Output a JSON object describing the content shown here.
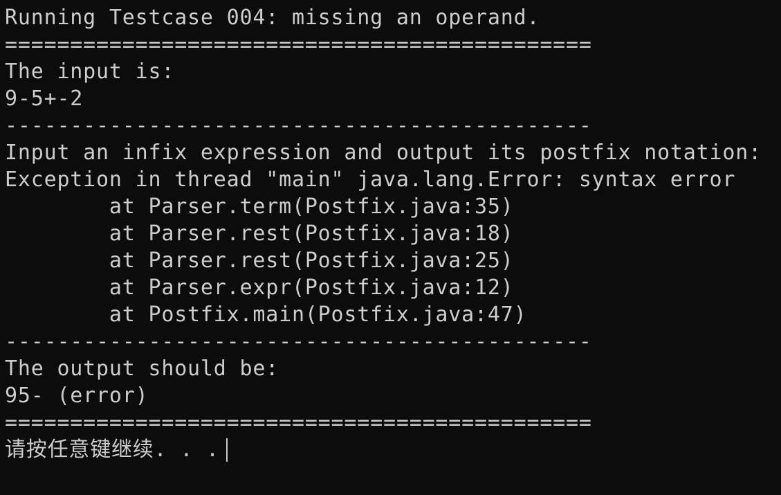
{
  "terminal": {
    "lines": [
      "Running Testcase 004: missing an operand.",
      "=============================================",
      "The input is:",
      "9-5+-2",
      "---------------------------------------------",
      "Input an infix expression and output its postfix notation:",
      "Exception in thread \"main\" java.lang.Error: syntax error",
      "        at Parser.term(Postfix.java:35)",
      "        at Parser.rest(Postfix.java:18)",
      "        at Parser.rest(Postfix.java:25)",
      "        at Parser.expr(Postfix.java:12)",
      "        at Postfix.main(Postfix.java:47)",
      "---------------------------------------------",
      "The output should be:",
      "95- (error)",
      "============================================="
    ],
    "prompt": "请按任意键继续. . ."
  },
  "colors": {
    "background": "#0c0c0c",
    "foreground": "#cccccc"
  }
}
